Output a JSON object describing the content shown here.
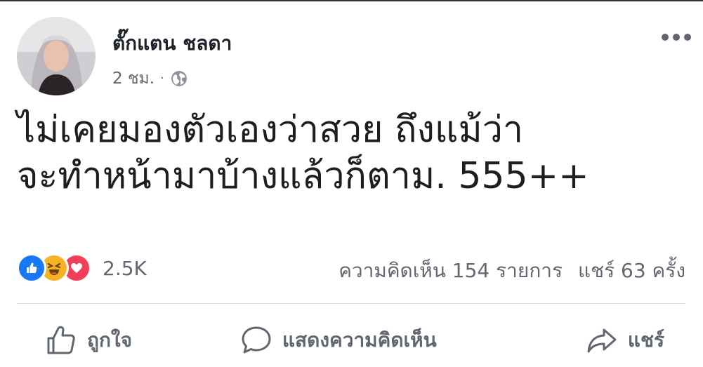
{
  "post": {
    "author": "ตั๊กแตน ชลดา",
    "time": "2 ชม.",
    "separator": "·",
    "privacy_icon": "globe-icon",
    "text": "ไม่เคยมองตัวเองว่าสวย  ถึงแม้ว่า\nจะทำหน้ามาบ้างแล้วก็ตาม. 555++"
  },
  "stats": {
    "reactions": [
      "like-reaction-icon",
      "haha-reaction-icon",
      "love-reaction-icon"
    ],
    "reaction_count": "2.5K",
    "comments": "ความคิดเห็น 154 รายการ",
    "shares": "แชร์ 63 ครั้ง"
  },
  "actions": {
    "like_label": "ถูกใจ",
    "comment_label": "แสดงความคิดเห็น",
    "share_label": "แชร์"
  },
  "colors": {
    "like": "#1877f2",
    "haha": "#f7b125",
    "love": "#f33e58",
    "muted_text": "#606770",
    "divider": "#dadde1"
  }
}
